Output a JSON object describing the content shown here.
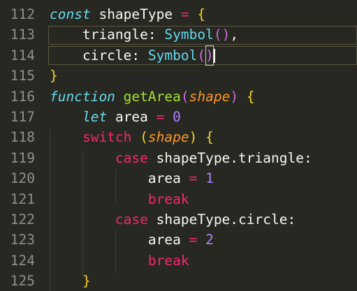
{
  "editor": {
    "theme_colors": {
      "background": "#272822",
      "line_number": "#8f908a",
      "keyword": "#f92672",
      "storage_italic": "#66d9ef",
      "function_name": "#a6e22e",
      "parameter": "#fd971f",
      "number": "#ae81ff",
      "plain": "#f8f8f2"
    },
    "lines": [
      {
        "n": "112",
        "tokens": [
          [
            "kw-it",
            "const"
          ],
          [
            "",
            ""
          ],
          [
            "",
            "shapeType"
          ],
          [
            "",
            ""
          ],
          [
            "op",
            "="
          ],
          [
            "",
            ""
          ],
          [
            "br",
            "{"
          ]
        ]
      },
      {
        "n": "113",
        "tokens": [
          [
            "",
            "    triangle: "
          ],
          [
            "sym",
            "Symbol"
          ],
          [
            "br2",
            "()"
          ],
          [
            "",
            ","
          ]
        ]
      },
      {
        "n": "114",
        "tokens": [
          [
            "",
            "    circle: "
          ],
          [
            "sym",
            "Symbol"
          ],
          [
            "br2",
            "("
          ],
          [
            "br2",
            "bracket-close",
            ")"
          ]
        ]
      },
      {
        "n": "115",
        "tokens": [
          [
            "br",
            "}"
          ]
        ]
      },
      {
        "n": "116",
        "tokens": [
          [
            "kw-it",
            "function"
          ],
          [
            "",
            ""
          ],
          [
            "fn",
            "getArea"
          ],
          [
            "br2",
            "("
          ],
          [
            "param",
            "shape"
          ],
          [
            "br2",
            ")"
          ],
          [
            "",
            ""
          ],
          [
            "br",
            "{"
          ]
        ]
      },
      {
        "n": "117",
        "tokens": [
          [
            "",
            "    "
          ],
          [
            "kw-it",
            "let"
          ],
          [
            "",
            ""
          ],
          [
            "",
            "area"
          ],
          [
            "",
            ""
          ],
          [
            "op",
            "="
          ],
          [
            "",
            ""
          ],
          [
            "num",
            "0"
          ]
        ]
      },
      {
        "n": "118",
        "tokens": [
          [
            "",
            "    "
          ],
          [
            "kw",
            "switch"
          ],
          [
            "",
            ""
          ],
          [
            "br",
            "("
          ],
          [
            "param",
            "shape"
          ],
          [
            "br",
            ")"
          ],
          [
            "",
            ""
          ],
          [
            "br",
            "{"
          ]
        ]
      },
      {
        "n": "119",
        "tokens": [
          [
            "",
            "        "
          ],
          [
            "kw",
            "case"
          ],
          [
            "",
            ""
          ],
          [
            "",
            "shapeType.triangle:"
          ]
        ]
      },
      {
        "n": "120",
        "tokens": [
          [
            "",
            "            "
          ],
          [
            "",
            "area"
          ],
          [
            "",
            ""
          ],
          [
            "op",
            "="
          ],
          [
            "",
            ""
          ],
          [
            "num",
            "1"
          ]
        ]
      },
      {
        "n": "121",
        "tokens": [
          [
            "",
            "            "
          ],
          [
            "kw",
            "break"
          ]
        ]
      },
      {
        "n": "122",
        "tokens": [
          [
            "",
            "        "
          ],
          [
            "kw",
            "case"
          ],
          [
            "",
            ""
          ],
          [
            "",
            "shapeType.circle:"
          ]
        ]
      },
      {
        "n": "123",
        "tokens": [
          [
            "",
            "            "
          ],
          [
            "",
            "area"
          ],
          [
            "",
            ""
          ],
          [
            "op",
            "="
          ],
          [
            "",
            ""
          ],
          [
            "num",
            "2"
          ]
        ]
      },
      {
        "n": "124",
        "tokens": [
          [
            "",
            "            "
          ],
          [
            "kw",
            "break"
          ]
        ]
      },
      {
        "n": "125",
        "tokens": [
          [
            "",
            "    "
          ],
          [
            "br",
            "}"
          ]
        ]
      }
    ]
  }
}
